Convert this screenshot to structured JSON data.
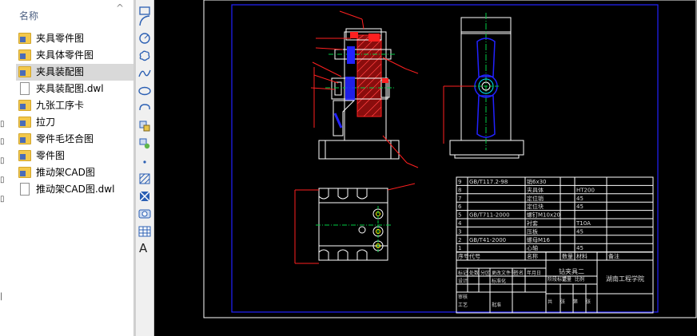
{
  "explorer": {
    "column_header": "名称",
    "items": [
      {
        "name": "夹具零件图",
        "type": "folder"
      },
      {
        "name": "夹具体零件图",
        "type": "folder"
      },
      {
        "name": "夹具装配图",
        "type": "folder",
        "selected": true
      },
      {
        "name": "夹具装配图.dwl",
        "type": "file"
      },
      {
        "name": "九张工序卡",
        "type": "folder"
      },
      {
        "name": "拉刀",
        "type": "folder"
      },
      {
        "name": "零件毛坯合图",
        "type": "folder"
      },
      {
        "name": "零件图",
        "type": "folder"
      },
      {
        "name": "推动架CAD图",
        "type": "folder"
      },
      {
        "name": "推动架CAD图.dwl",
        "type": "file"
      }
    ]
  },
  "toolbar": {
    "tools": [
      "rectangle-icon",
      "arc-icon",
      "circle-icon",
      "revision-cloud-icon",
      "spline-icon",
      "ellipse-icon",
      "ellipse-arc-icon",
      "insert-block-icon",
      "make-block-icon",
      "point-icon",
      "hatch-icon",
      "gradient-icon",
      "region-icon",
      "table-icon"
    ],
    "text_tool": "A"
  },
  "drawing": {
    "bom_rows": [
      {
        "no": "9",
        "std": "GB/T117.2-98",
        "name": "销6x30",
        "qty": "",
        "material": ""
      },
      {
        "no": "8",
        "std": "",
        "name": "夹具体",
        "qty": "",
        "material": "HT200"
      },
      {
        "no": "7",
        "std": "",
        "name": "定位销",
        "qty": "",
        "material": "45"
      },
      {
        "no": "6",
        "std": "",
        "name": "定位块",
        "qty": "",
        "material": "45"
      },
      {
        "no": "5",
        "std": "GB/T711-2000",
        "name": "螺钉M10x20",
        "qty": "",
        "material": ""
      },
      {
        "no": "4",
        "std": "",
        "name": "衬套",
        "qty": "",
        "material": "T10A"
      },
      {
        "no": "3",
        "std": "",
        "name": "压板",
        "qty": "",
        "material": "45"
      },
      {
        "no": "2",
        "std": "GB/T41-2000",
        "name": "螺母M16",
        "qty": "",
        "material": ""
      },
      {
        "no": "1",
        "std": "",
        "name": "心轴",
        "qty": "",
        "material": "45"
      }
    ],
    "bom_header": {
      "no": "序号",
      "std": "代号",
      "name": "名称",
      "qty": "数量",
      "material": "材料",
      "remark": "备注"
    },
    "title_block": {
      "drawing_name": "钻夹具二",
      "school": "湖南工程学院",
      "labels": [
        "标记",
        "处数",
        "分区",
        "更改文件号",
        "签名",
        "年月日",
        "设计",
        "标准化",
        "阶段标记",
        "重量",
        "比例",
        "审核",
        "工艺",
        "批准",
        "共",
        "张",
        "第",
        "张"
      ]
    }
  },
  "colors": {
    "white": "#ffffff",
    "red": "#ff2020",
    "blue": "#2222ff",
    "green": "#00cc44",
    "cyan": "#00e5ff",
    "magenta": "#ff00ff",
    "yellow": "#ffff00",
    "brown_red": "#c01010"
  }
}
